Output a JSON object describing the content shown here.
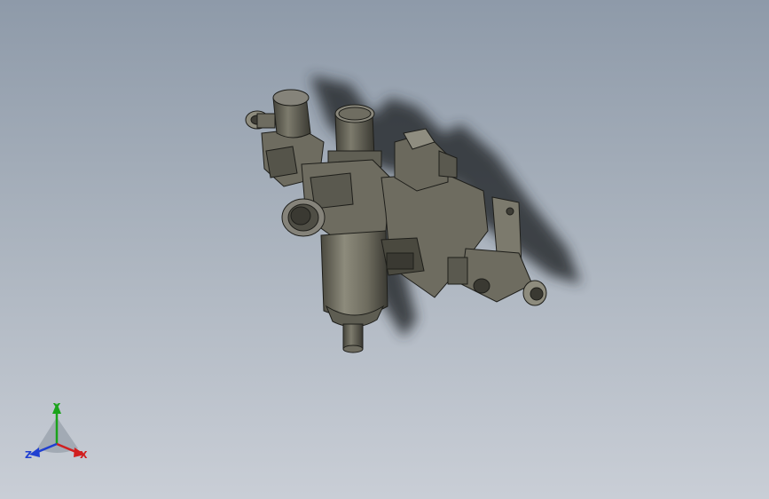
{
  "viewport": {
    "background_top": "#8e9aa9",
    "background_bottom": "#c9ced6"
  },
  "model": {
    "part_color": "#6e6c60",
    "part_dark": "#3d3c36",
    "part_light": "#9a988a",
    "shadow_color": "#2b2d33"
  },
  "triad": {
    "x_label": "X",
    "y_label": "Y",
    "z_label": "Z",
    "x_color": "#d11f1f",
    "y_color": "#1aa31a",
    "z_color": "#1f3fd1"
  }
}
